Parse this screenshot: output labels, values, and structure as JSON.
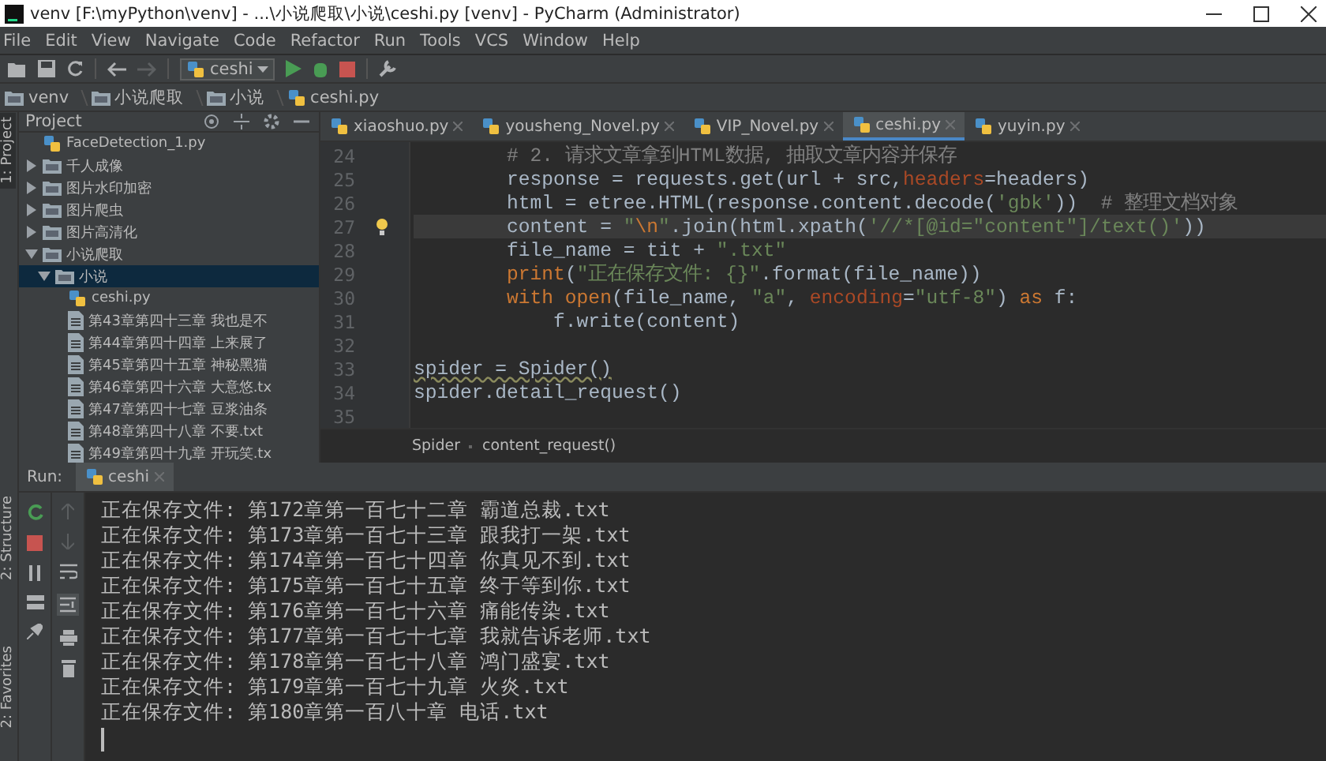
{
  "window": {
    "title": "venv [F:\\myPython\\venv] - ...\\小说爬取\\小说\\ceshi.py [venv] - PyCharm (Administrator)"
  },
  "menu": [
    "File",
    "Edit",
    "View",
    "Navigate",
    "Code",
    "Refactor",
    "Run",
    "Tools",
    "VCS",
    "Window",
    "Help"
  ],
  "toolbar": {
    "run_config": "ceshi"
  },
  "breadcrumbs": [
    {
      "label": "venv",
      "kind": "folder"
    },
    {
      "label": "小说爬取",
      "kind": "folder"
    },
    {
      "label": "小说",
      "kind": "folder"
    },
    {
      "label": "ceshi.py",
      "kind": "python"
    }
  ],
  "side_stripe": {
    "project": "1: Project",
    "structure": "2: Structure",
    "favorites": "2: Favorites"
  },
  "project_panel": {
    "title": "Project",
    "tree": [
      {
        "name": "FaceDetection_1.py",
        "kind": "python",
        "selected": false
      },
      {
        "name": "千人成像",
        "kind": "folder",
        "expanded": false,
        "selected": false
      },
      {
        "name": "图片水印加密",
        "kind": "folder",
        "expanded": false,
        "selected": false
      },
      {
        "name": "图片爬虫",
        "kind": "folder",
        "expanded": false,
        "selected": false
      },
      {
        "name": "图片高清化",
        "kind": "folder",
        "expanded": false,
        "selected": false
      },
      {
        "name": "小说爬取",
        "kind": "folder",
        "expanded": true,
        "selected": false,
        "children": [
          {
            "name": "小说",
            "kind": "folder",
            "expanded": true,
            "selected": true,
            "children": [
              {
                "name": "ceshi.py",
                "kind": "python",
                "selected": false
              },
              {
                "name": "第43章第四十三章 我也是不",
                "kind": "text",
                "selected": false
              },
              {
                "name": "第44章第四十四章 上来展了",
                "kind": "text",
                "selected": false
              },
              {
                "name": "第45章第四十五章 神秘黑猫",
                "kind": "text",
                "selected": false
              },
              {
                "name": "第46章第四十六章 大意悠.tx",
                "kind": "text",
                "selected": false
              },
              {
                "name": "第47章第四十七章 豆浆油条",
                "kind": "text",
                "selected": false
              },
              {
                "name": "第48章第四十八章 不要.txt",
                "kind": "text",
                "selected": false
              },
              {
                "name": "第49章第四十九章 开玩笑.tx",
                "kind": "text",
                "selected": false
              }
            ]
          }
        ]
      }
    ]
  },
  "editor": {
    "tabs": [
      {
        "label": "xiaoshuo.py",
        "selected": false
      },
      {
        "label": "yousheng_Novel.py",
        "selected": false
      },
      {
        "label": "VIP_Novel.py",
        "selected": false
      },
      {
        "label": "ceshi.py",
        "selected": true
      },
      {
        "label": "yuyin.py",
        "selected": false
      }
    ],
    "lines": [
      {
        "number": "24",
        "current": false,
        "kind": "body",
        "tokens": [
          {
            "kind": "comment",
            "text": "# 2. 请求文章拿到HTML数据, 抽取文章内容并保存"
          }
        ]
      },
      {
        "number": "25",
        "current": false,
        "kind": "body",
        "tokens": [
          {
            "kind": "plain",
            "text": "response = requests.get(url + src,"
          },
          {
            "kind": "kwarg",
            "text": "headers"
          },
          {
            "kind": "plain",
            "text": "=headers)"
          }
        ]
      },
      {
        "number": "26",
        "current": false,
        "kind": "body",
        "tokens": [
          {
            "kind": "plain",
            "text": "html = etree.HTML(response.content.decode("
          },
          {
            "kind": "string",
            "text": "'gbk'"
          },
          {
            "kind": "plain",
            "text": "))  "
          },
          {
            "kind": "comment",
            "text": "# 整理文档对象"
          }
        ]
      },
      {
        "number": "27",
        "current": true,
        "kind": "body",
        "tokens": [
          {
            "kind": "plain",
            "text": "content = "
          },
          {
            "kind": "string",
            "text": "\""
          },
          {
            "kind": "keyword",
            "text": "\\n"
          },
          {
            "kind": "string",
            "text": "\""
          },
          {
            "kind": "plain",
            "text": ".join(html.xpath("
          },
          {
            "kind": "string",
            "text": "'//*[@id=\"content\"]/text()'"
          },
          {
            "kind": "plain",
            "text": "))"
          }
        ]
      },
      {
        "number": "28",
        "current": false,
        "kind": "body",
        "tokens": [
          {
            "kind": "plain",
            "text": "file_name = tit + "
          },
          {
            "kind": "string",
            "text": "\".txt\""
          }
        ]
      },
      {
        "number": "29",
        "current": false,
        "kind": "body",
        "tokens": [
          {
            "kind": "keyword",
            "text": "print"
          },
          {
            "kind": "plain",
            "text": "("
          },
          {
            "kind": "string",
            "text": "\"正在保存文件: {}\""
          },
          {
            "kind": "plain",
            "text": ".format(file_name))"
          }
        ]
      },
      {
        "number": "30",
        "current": false,
        "kind": "body",
        "tokens": [
          {
            "kind": "keyword",
            "text": "with open"
          },
          {
            "kind": "plain",
            "text": "(file_name, "
          },
          {
            "kind": "string",
            "text": "\"a\""
          },
          {
            "kind": "plain",
            "text": ", "
          },
          {
            "kind": "kwarg",
            "text": "encoding"
          },
          {
            "kind": "plain",
            "text": "="
          },
          {
            "kind": "string",
            "text": "\"utf-8\""
          },
          {
            "kind": "plain",
            "text": ") "
          },
          {
            "kind": "keyword",
            "text": "as"
          },
          {
            "kind": "plain",
            "text": " f:"
          }
        ]
      },
      {
        "number": "31",
        "current": false,
        "kind": "nested",
        "tokens": [
          {
            "kind": "plain",
            "text": "f.write(content)"
          }
        ]
      },
      {
        "number": "32",
        "current": false
      },
      {
        "number": "33",
        "current": false,
        "kind": "top",
        "tokens": [
          {
            "kind": "warning",
            "text": "spider = Spider()"
          }
        ]
      },
      {
        "number": "34",
        "current": false,
        "kind": "top",
        "tokens": [
          {
            "kind": "plain",
            "text": "spider.detail_request()"
          }
        ]
      },
      {
        "number": "35",
        "current": false
      }
    ],
    "breadcrumbs": [
      "Spider",
      "content_request()"
    ]
  },
  "run": {
    "label": "Run:",
    "tab": "ceshi",
    "output": [
      "正在保存文件: 第172章第一百七十二章 霸道总裁.txt",
      "正在保存文件: 第173章第一百七十三章 跟我打一架.txt",
      "正在保存文件: 第174章第一百七十四章 你真见不到.txt",
      "正在保存文件: 第175章第一百七十五章 终于等到你.txt",
      "正在保存文件: 第176章第一百七十六章 痛能传染.txt",
      "正在保存文件: 第177章第一百七十七章 我就告诉老师.txt",
      "正在保存文件: 第178章第一百七十八章 鸿门盛宴.txt",
      "正在保存文件: 第179章第一百七十九章 火炎.txt",
      "正在保存文件: 第180章第一百八十章 电话.txt"
    ]
  }
}
